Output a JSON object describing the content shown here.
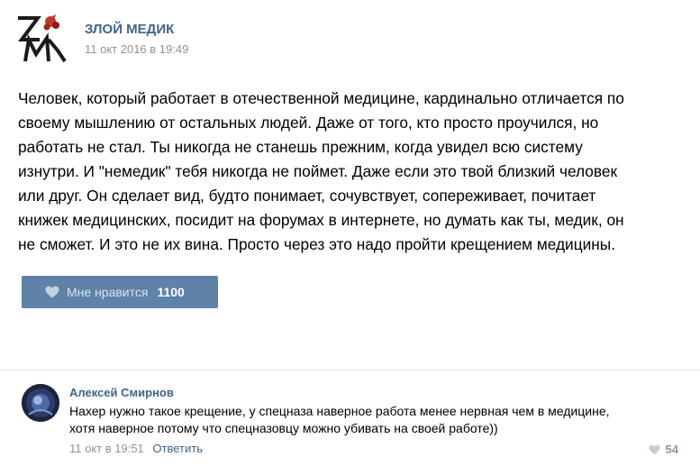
{
  "post": {
    "author": "ЗЛОЙ МЕДИК",
    "date": "11 окт 2016 в 19:49",
    "logo": "zm-logo-icon",
    "text": "Человек, который работает в отечественной медицине, кардинально отличается по\nсвоему мышлению от остальных людей. Даже от того, кто просто проучился, но\nработать не стал. Ты никогда не станешь прежним, когда увидел всю систему\nизнутри. И \"немедик\" тебя никогда не поймет. Даже если это твой близкий человек\nили друг. Он сделает вид, будто понимает, сочувствует, сопереживает, почитает\nкнижек медицинских, посидит на форумах в интернете, но думать как ты, медик, он\nне сможет. И это не их вина. Просто через это надо пройти крещением медицины.",
    "like_label": "Мне нравится",
    "like_count": "1100"
  },
  "comment": {
    "author": "Алексей Смирнов",
    "text": "Нахер нужно такое крещение, у спецназа наверное работа менее нервная чем в медицине,\nхотя наверное потому что спецназовцу можно убивать на своей работе))",
    "date": "11 окт в 19:51",
    "reply_label": "Ответить",
    "like_count": "54"
  },
  "colors": {
    "accent": "#42648b",
    "like_button": "#5e82a8",
    "muted": "#939393"
  }
}
